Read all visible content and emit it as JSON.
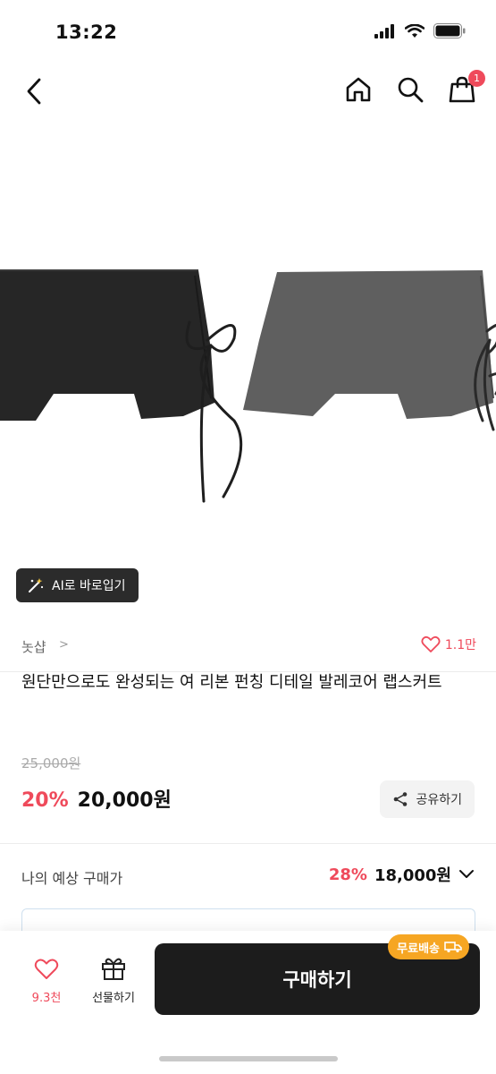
{
  "status_bar": {
    "time": "13:22"
  },
  "nav": {
    "cart_badge": "1"
  },
  "ai_chip": {
    "label": "AI로 바로입기"
  },
  "store": {
    "name": "놋샵",
    "chevron": ">",
    "likes": "1.1만"
  },
  "product": {
    "title": " 원단만으로도 완성되는 여 리본 펀칭 디테일 발레코어 랩스커트",
    "original_price": "25,000원",
    "discount": "20%",
    "price": "20,000원",
    "share_label": "공유하기"
  },
  "expected": {
    "label": "나의 예상 구매가",
    "discount": "28%",
    "price": "18,000원"
  },
  "bottom_bar": {
    "like_count": "9.3천",
    "gift_label": "선물하기",
    "buy_label": "구매하기",
    "free_shipping": "무료배송"
  },
  "colors": {
    "accent": "#ef4a5b",
    "dark": "#1c1c1c",
    "shipping": "#f6a623"
  },
  "icons": [
    "back-arrow-icon",
    "home-icon",
    "search-icon",
    "shopping-bag-icon",
    "magic-wand-icon",
    "heart-icon",
    "share-icon",
    "chevron-down-icon",
    "gift-icon",
    "truck-icon"
  ]
}
